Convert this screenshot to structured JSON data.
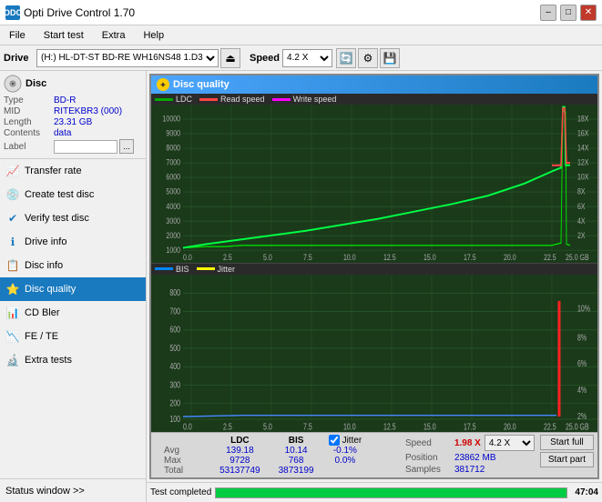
{
  "app": {
    "title": "Opti Drive Control 1.70",
    "icon": "ODC"
  },
  "titlebar": {
    "minimize": "–",
    "maximize": "□",
    "close": "✕"
  },
  "menubar": {
    "items": [
      "File",
      "Start test",
      "Extra",
      "Help"
    ]
  },
  "topbar": {
    "drive_label": "Drive",
    "drive_value": "(H:) HL-DT-ST BD-RE  WH16NS48 1.D3",
    "speed_label": "Speed",
    "speed_value": "4.2 X"
  },
  "sidebar": {
    "disc_label": "Disc",
    "disc_type_label": "Type",
    "disc_type_value": "BD-R",
    "disc_mid_label": "MID",
    "disc_mid_value": "RITEKBR3 (000)",
    "disc_length_label": "Length",
    "disc_length_value": "23.31 GB",
    "disc_contents_label": "Contents",
    "disc_contents_value": "data",
    "disc_label_label": "Label",
    "disc_label_input": "",
    "nav_items": [
      {
        "id": "transfer-rate",
        "label": "Transfer rate",
        "icon": "📈"
      },
      {
        "id": "create-test-disc",
        "label": "Create test disc",
        "icon": "💿"
      },
      {
        "id": "verify-test-disc",
        "label": "Verify test disc",
        "icon": "✔"
      },
      {
        "id": "drive-info",
        "label": "Drive info",
        "icon": "ℹ"
      },
      {
        "id": "disc-info",
        "label": "Disc info",
        "icon": "📋"
      },
      {
        "id": "disc-quality",
        "label": "Disc quality",
        "icon": "⭐",
        "active": true
      },
      {
        "id": "cd-bler",
        "label": "CD Bler",
        "icon": "📊"
      },
      {
        "id": "fe-te",
        "label": "FE / TE",
        "icon": "📉"
      },
      {
        "id": "extra-tests",
        "label": "Extra tests",
        "icon": "🔬"
      }
    ],
    "status_window": "Status window >>"
  },
  "disc_quality": {
    "panel_title": "Disc quality",
    "legend_top": {
      "ldc": "LDC",
      "read_speed": "Read speed",
      "write_speed": "Write speed"
    },
    "legend_bottom": {
      "bis": "BIS",
      "jitter": "Jitter"
    },
    "chart_top": {
      "y_max": 10000,
      "y_labels": [
        "10000",
        "9000",
        "8000",
        "7000",
        "6000",
        "5000",
        "4000",
        "3000",
        "2000",
        "1000"
      ],
      "y_labels_right": [
        "18X",
        "16X",
        "14X",
        "12X",
        "10X",
        "8X",
        "6X",
        "4X",
        "2X"
      ],
      "x_labels": [
        "0.0",
        "2.5",
        "5.0",
        "7.5",
        "10.0",
        "12.5",
        "15.0",
        "17.5",
        "20.0",
        "22.5",
        "25.0"
      ],
      "x_unit": "GB"
    },
    "chart_bottom": {
      "y_max": 800,
      "y_labels": [
        "800",
        "700",
        "600",
        "500",
        "400",
        "300",
        "200",
        "100"
      ],
      "y_labels_right": [
        "10%",
        "8%",
        "6%",
        "4%",
        "2%"
      ],
      "x_labels": [
        "0.0",
        "2.5",
        "5.0",
        "7.5",
        "10.0",
        "12.5",
        "15.0",
        "17.5",
        "20.0",
        "22.5",
        "25.0"
      ],
      "x_unit": "GB"
    },
    "stats": {
      "headers": [
        "LDC",
        "BIS",
        "",
        "Jitter",
        "Speed",
        ""
      ],
      "avg_label": "Avg",
      "avg_ldc": "139.18",
      "avg_bis": "10.14",
      "avg_jitter": "-0.1%",
      "max_label": "Max",
      "max_ldc": "9728",
      "max_bis": "768",
      "max_jitter": "0.0%",
      "total_label": "Total",
      "total_ldc": "53137749",
      "total_bis": "3873199",
      "speed_label": "Speed",
      "speed_value": "1.98 X",
      "position_label": "Position",
      "position_value": "23862 MB",
      "samples_label": "Samples",
      "samples_value": "381712",
      "jitter_checked": true,
      "start_full": "Start full",
      "start_part": "Start part",
      "speed_combo": "4.2 X"
    }
  },
  "bottom": {
    "status": "Test completed",
    "progress": 100,
    "time": "47:04"
  }
}
